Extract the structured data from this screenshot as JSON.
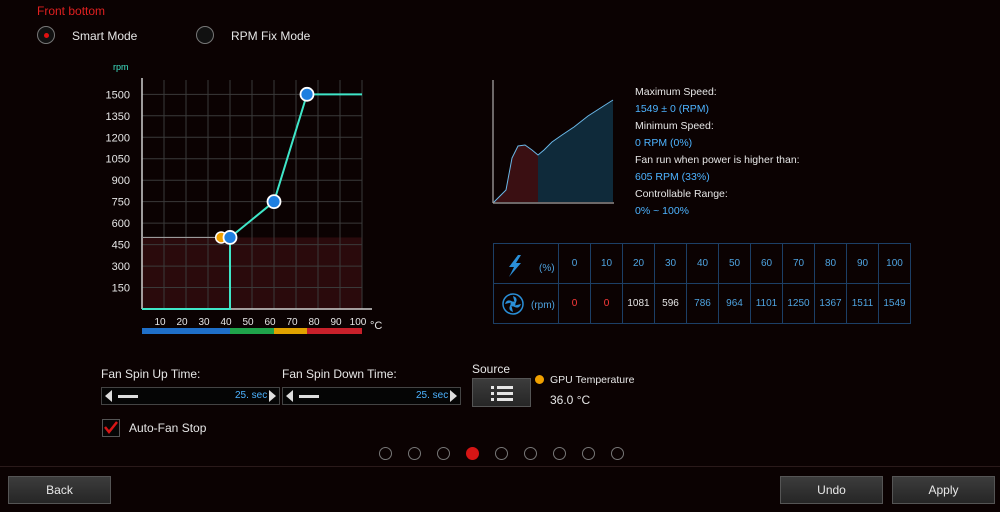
{
  "header": {
    "title": "Front bottom"
  },
  "modes": [
    {
      "label": "Smart Mode",
      "selected": true
    },
    {
      "label": "RPM Fix Mode",
      "selected": false
    }
  ],
  "chart_data": {
    "type": "line",
    "ylabel": "rpm",
    "xunit": "°C",
    "xlim": [
      0,
      100
    ],
    "ylim": [
      0,
      1600
    ],
    "xticks": [
      10,
      20,
      30,
      40,
      50,
      60,
      70,
      80,
      90,
      100
    ],
    "yticks": [
      150,
      300,
      450,
      600,
      750,
      900,
      1050,
      1200,
      1350,
      1500
    ],
    "curve": [
      [
        0,
        0
      ],
      [
        40,
        0
      ],
      [
        40,
        500
      ],
      [
        60,
        750
      ],
      [
        75,
        1500
      ],
      [
        100,
        1500
      ]
    ],
    "control_points": [
      [
        40,
        500
      ],
      [
        60,
        750
      ],
      [
        75,
        1500
      ]
    ],
    "current_point": [
      36,
      500
    ],
    "band_colors": [
      "#1f6fc8",
      "#1fa34a",
      "#e0a200",
      "#c8202a"
    ],
    "band_ranges": [
      [
        0,
        40
      ],
      [
        40,
        60
      ],
      [
        60,
        75
      ],
      [
        75,
        100
      ]
    ]
  },
  "info": {
    "max_speed_label": "Maximum Speed:",
    "max_speed_value": "1549 ± 0 (RPM)",
    "min_speed_label": "Minimum Speed:",
    "min_speed_value": "0 RPM (0%)",
    "run_label": "Fan run when power is higher than:",
    "run_value": "605 RPM (33%)",
    "range_label": "Controllable Range:",
    "range_value": "0% ~ 100%"
  },
  "speed_table": {
    "power_unit": "(%)",
    "rpm_unit": "(rpm)",
    "percents": [
      "0",
      "10",
      "20",
      "30",
      "40",
      "50",
      "60",
      "70",
      "80",
      "90",
      "100"
    ],
    "rpms": [
      "0",
      "0",
      "1081",
      "596",
      "786",
      "964",
      "1101",
      "1250",
      "1367",
      "1511",
      "1549"
    ]
  },
  "controls": {
    "spin_up_label": "Fan Spin Up Time:",
    "spin_up_value": "25. sec",
    "spin_down_label": "Fan Spin Down Time:",
    "spin_down_value": "25. sec",
    "source_label": "Source",
    "sensor_name": "GPU Temperature",
    "sensor_value": "36.0 °C",
    "auto_stop_label": "Auto-Fan Stop",
    "auto_stop_checked": true
  },
  "pager": {
    "count": 9,
    "active": 3
  },
  "footer": {
    "back": "Back",
    "undo": "Undo",
    "apply": "Apply"
  }
}
